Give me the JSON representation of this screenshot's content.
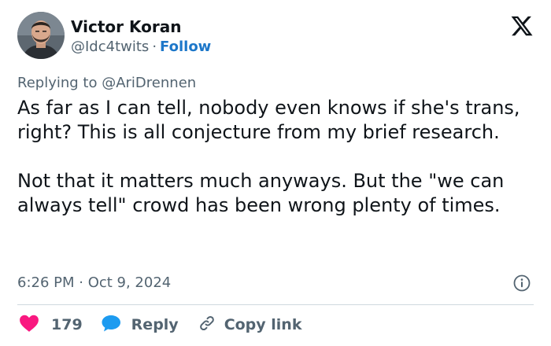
{
  "author": {
    "display_name": "Victor Koran",
    "handle": "@Idc4twits",
    "separator": "·",
    "follow_label": "Follow"
  },
  "reply_context": {
    "prefix": "Replying to",
    "target": "@AriDrennen"
  },
  "tweet": {
    "text": "As far as I can tell, nobody even knows if she's trans, right? This is all conjecture from my brief research.\n\nNot that it matters much anyways. But the \"we can always tell\" crowd has been wrong plenty of times.",
    "timestamp": "6:26 PM · Oct 9, 2024"
  },
  "actions": {
    "like_count": "179",
    "reply_label": "Reply",
    "copy_link_label": "Copy link"
  },
  "icons": {
    "brand": "x-logo-icon",
    "info": "info-icon",
    "like": "heart-icon",
    "reply": "speech-bubble-icon",
    "copy": "link-icon"
  },
  "colors": {
    "text_primary": "#0f1419",
    "text_secondary": "#536471",
    "follow": "#1d77c9",
    "like": "#f91880",
    "reply": "#1d9bf0",
    "divider": "#cfd9de"
  }
}
